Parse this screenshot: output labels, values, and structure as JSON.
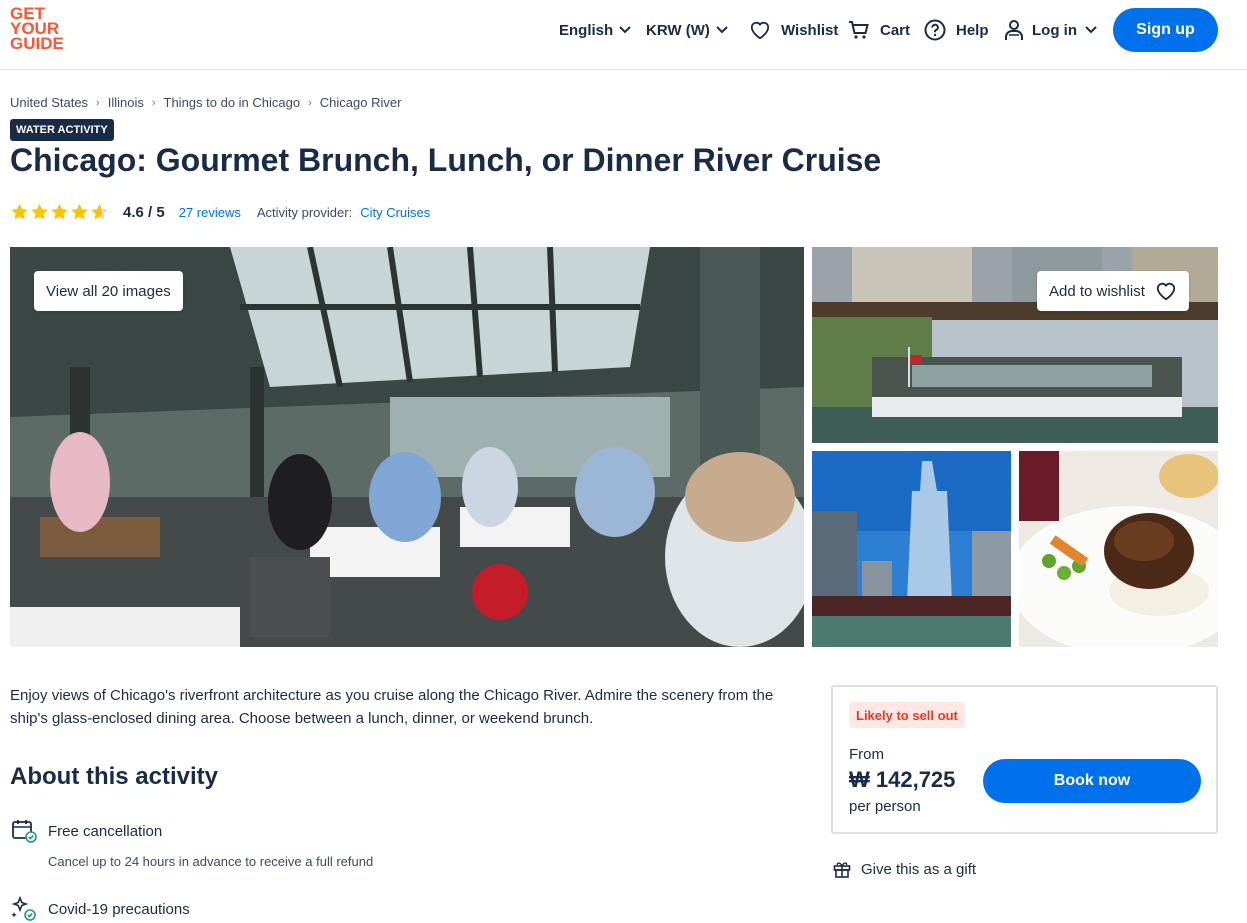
{
  "brand": {
    "logo_lines": [
      "GET",
      "YOUR",
      "GUIDE"
    ],
    "color": "#ff5533",
    "accent": "#0071eb",
    "navy": "#1a2b49"
  },
  "header": {
    "language": "English",
    "currency": "KRW (W)",
    "wishlist": "Wishlist",
    "cart": "Cart",
    "help": "Help",
    "login": "Log in",
    "signup": "Sign up"
  },
  "breadcrumb": [
    "United States",
    "Illinois",
    "Things to do in Chicago",
    "Chicago River"
  ],
  "badge": "WATER ACTIVITY",
  "title": "Chicago: Gourmet Brunch, Lunch, or Dinner River Cruise",
  "rating": {
    "stars_value": 4.6,
    "score": "4.6 / 5",
    "reviews": "27 reviews",
    "provider_label": "Activity provider:",
    "provider": "City Cruises"
  },
  "gallery": {
    "view_all": "View all 20 images",
    "add_to_wishlist": "Add to wishlist",
    "images": [
      "dining-room-photo",
      "river-boat-photo",
      "trump-tower-photo",
      "steak-dish-photo"
    ]
  },
  "description": "Enjoy views of Chicago's riverfront architecture as you cruise along the Chicago River. Admire the scenery from the ship's glass-enclosed dining area. Choose between a lunch, dinner, or weekend brunch.",
  "about": {
    "heading": "About this activity",
    "features": [
      {
        "icon": "calendar-check-icon",
        "title": "Free cancellation",
        "subtitle": "Cancel up to 24 hours in advance to receive a full refund"
      },
      {
        "icon": "sparkle-shield-icon",
        "title": "Covid-19 precautions"
      }
    ]
  },
  "booking": {
    "badge": "Likely to sell out",
    "from": "From",
    "price": "₩ 142,725",
    "per": "per person",
    "cta": "Book now"
  },
  "gift": "Give this as a gift"
}
